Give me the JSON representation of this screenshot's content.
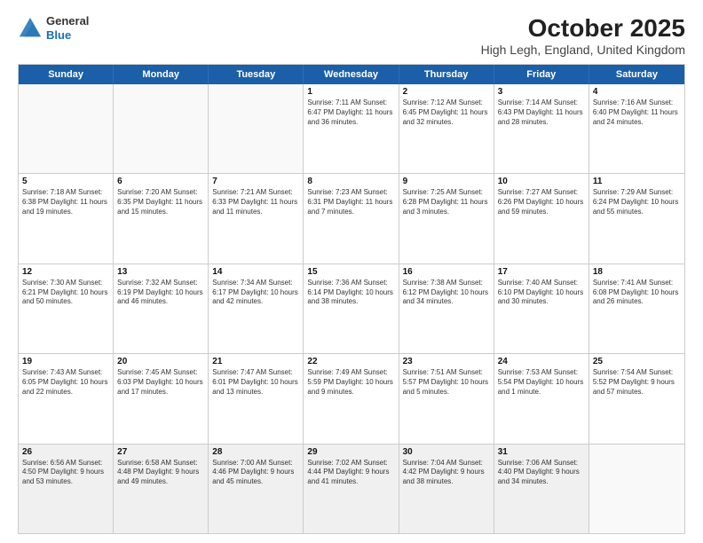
{
  "logo": {
    "line1": "General",
    "line2": "Blue"
  },
  "title": "October 2025",
  "subtitle": "High Legh, England, United Kingdom",
  "days": [
    "Sunday",
    "Monday",
    "Tuesday",
    "Wednesday",
    "Thursday",
    "Friday",
    "Saturday"
  ],
  "weeks": [
    [
      {
        "day": "",
        "info": ""
      },
      {
        "day": "",
        "info": ""
      },
      {
        "day": "",
        "info": ""
      },
      {
        "day": "1",
        "info": "Sunrise: 7:11 AM\nSunset: 6:47 PM\nDaylight: 11 hours\nand 36 minutes."
      },
      {
        "day": "2",
        "info": "Sunrise: 7:12 AM\nSunset: 6:45 PM\nDaylight: 11 hours\nand 32 minutes."
      },
      {
        "day": "3",
        "info": "Sunrise: 7:14 AM\nSunset: 6:43 PM\nDaylight: 11 hours\nand 28 minutes."
      },
      {
        "day": "4",
        "info": "Sunrise: 7:16 AM\nSunset: 6:40 PM\nDaylight: 11 hours\nand 24 minutes."
      }
    ],
    [
      {
        "day": "5",
        "info": "Sunrise: 7:18 AM\nSunset: 6:38 PM\nDaylight: 11 hours\nand 19 minutes."
      },
      {
        "day": "6",
        "info": "Sunrise: 7:20 AM\nSunset: 6:35 PM\nDaylight: 11 hours\nand 15 minutes."
      },
      {
        "day": "7",
        "info": "Sunrise: 7:21 AM\nSunset: 6:33 PM\nDaylight: 11 hours\nand 11 minutes."
      },
      {
        "day": "8",
        "info": "Sunrise: 7:23 AM\nSunset: 6:31 PM\nDaylight: 11 hours\nand 7 minutes."
      },
      {
        "day": "9",
        "info": "Sunrise: 7:25 AM\nSunset: 6:28 PM\nDaylight: 11 hours\nand 3 minutes."
      },
      {
        "day": "10",
        "info": "Sunrise: 7:27 AM\nSunset: 6:26 PM\nDaylight: 10 hours\nand 59 minutes."
      },
      {
        "day": "11",
        "info": "Sunrise: 7:29 AM\nSunset: 6:24 PM\nDaylight: 10 hours\nand 55 minutes."
      }
    ],
    [
      {
        "day": "12",
        "info": "Sunrise: 7:30 AM\nSunset: 6:21 PM\nDaylight: 10 hours\nand 50 minutes."
      },
      {
        "day": "13",
        "info": "Sunrise: 7:32 AM\nSunset: 6:19 PM\nDaylight: 10 hours\nand 46 minutes."
      },
      {
        "day": "14",
        "info": "Sunrise: 7:34 AM\nSunset: 6:17 PM\nDaylight: 10 hours\nand 42 minutes."
      },
      {
        "day": "15",
        "info": "Sunrise: 7:36 AM\nSunset: 6:14 PM\nDaylight: 10 hours\nand 38 minutes."
      },
      {
        "day": "16",
        "info": "Sunrise: 7:38 AM\nSunset: 6:12 PM\nDaylight: 10 hours\nand 34 minutes."
      },
      {
        "day": "17",
        "info": "Sunrise: 7:40 AM\nSunset: 6:10 PM\nDaylight: 10 hours\nand 30 minutes."
      },
      {
        "day": "18",
        "info": "Sunrise: 7:41 AM\nSunset: 6:08 PM\nDaylight: 10 hours\nand 26 minutes."
      }
    ],
    [
      {
        "day": "19",
        "info": "Sunrise: 7:43 AM\nSunset: 6:05 PM\nDaylight: 10 hours\nand 22 minutes."
      },
      {
        "day": "20",
        "info": "Sunrise: 7:45 AM\nSunset: 6:03 PM\nDaylight: 10 hours\nand 17 minutes."
      },
      {
        "day": "21",
        "info": "Sunrise: 7:47 AM\nSunset: 6:01 PM\nDaylight: 10 hours\nand 13 minutes."
      },
      {
        "day": "22",
        "info": "Sunrise: 7:49 AM\nSunset: 5:59 PM\nDaylight: 10 hours\nand 9 minutes."
      },
      {
        "day": "23",
        "info": "Sunrise: 7:51 AM\nSunset: 5:57 PM\nDaylight: 10 hours\nand 5 minutes."
      },
      {
        "day": "24",
        "info": "Sunrise: 7:53 AM\nSunset: 5:54 PM\nDaylight: 10 hours\nand 1 minute."
      },
      {
        "day": "25",
        "info": "Sunrise: 7:54 AM\nSunset: 5:52 PM\nDaylight: 9 hours\nand 57 minutes."
      }
    ],
    [
      {
        "day": "26",
        "info": "Sunrise: 6:56 AM\nSunset: 4:50 PM\nDaylight: 9 hours\nand 53 minutes."
      },
      {
        "day": "27",
        "info": "Sunrise: 6:58 AM\nSunset: 4:48 PM\nDaylight: 9 hours\nand 49 minutes."
      },
      {
        "day": "28",
        "info": "Sunrise: 7:00 AM\nSunset: 4:46 PM\nDaylight: 9 hours\nand 45 minutes."
      },
      {
        "day": "29",
        "info": "Sunrise: 7:02 AM\nSunset: 4:44 PM\nDaylight: 9 hours\nand 41 minutes."
      },
      {
        "day": "30",
        "info": "Sunrise: 7:04 AM\nSunset: 4:42 PM\nDaylight: 9 hours\nand 38 minutes."
      },
      {
        "day": "31",
        "info": "Sunrise: 7:06 AM\nSunset: 4:40 PM\nDaylight: 9 hours\nand 34 minutes."
      },
      {
        "day": "",
        "info": ""
      }
    ]
  ]
}
